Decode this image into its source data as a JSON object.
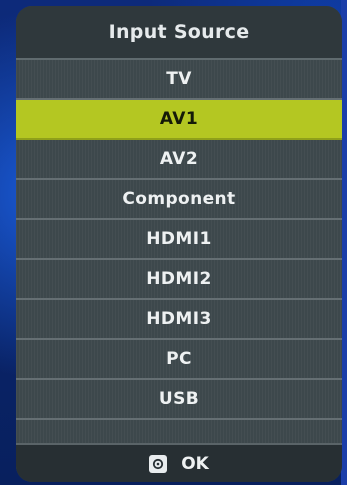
{
  "menu": {
    "title": "Input Source",
    "items": [
      {
        "label": "TV",
        "selected": false
      },
      {
        "label": "AV1",
        "selected": true
      },
      {
        "label": "AV2",
        "selected": false
      },
      {
        "label": "Component",
        "selected": false
      },
      {
        "label": "HDMI1",
        "selected": false
      },
      {
        "label": "HDMI2",
        "selected": false
      },
      {
        "label": "HDMI3",
        "selected": false
      },
      {
        "label": "PC",
        "selected": false
      },
      {
        "label": "USB",
        "selected": false
      }
    ],
    "footer": {
      "icon": "ok-button-icon",
      "label": "OK"
    }
  },
  "colors": {
    "selected_background": "#b4c722",
    "menu_background": "#3f4a4e",
    "backdrop": "#0d2a7a"
  }
}
